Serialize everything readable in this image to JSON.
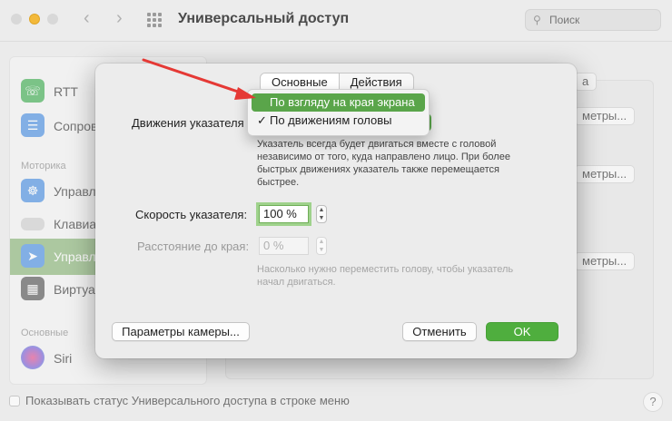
{
  "window": {
    "title": "Универсальный доступ",
    "search_placeholder": "Поиск",
    "back_icon": "‹",
    "forward_icon": "›"
  },
  "sidebar": {
    "items": [
      {
        "label": "RTT",
        "icon": "rtt-icon",
        "color": "#3fae52"
      },
      {
        "label": "Сопров",
        "icon": "captions-icon",
        "color": "#4a90e2"
      },
      {
        "label": "Управл",
        "icon": "switch-control-icon",
        "color": "#4a90e2"
      },
      {
        "label": "Клавиат",
        "icon": "keyboard-icon",
        "color": "#d0d0d0"
      },
      {
        "label": "Управл",
        "icon": "pointer-icon",
        "color": "#4a90e2"
      },
      {
        "label": "Виртуа",
        "icon": "virtual-keyboard-icon",
        "color": "#555555"
      },
      {
        "label": "Siri",
        "icon": "siri-icon",
        "color": "#7a5cd6"
      }
    ],
    "sections": {
      "motor": "Моторика",
      "general": "Основные"
    }
  },
  "background": {
    "params_button": "метры...",
    "params_button_top": "а",
    "footer_checkbox_label": "Показывать статус Универсального доступа в строке меню",
    "help": "?"
  },
  "dialog": {
    "tabs": [
      {
        "label": "Основные",
        "active": true
      },
      {
        "label": "Действия",
        "active": false
      }
    ],
    "movement_label": "Движения указателя",
    "dropdown": {
      "options": [
        {
          "label": "По взгляду на края экрана",
          "highlighted": true,
          "checked": false
        },
        {
          "label": "По движениям головы",
          "highlighted": false,
          "checked": true
        }
      ],
      "check_mark": "✓"
    },
    "movement_description": "Указатель всегда будет двигаться вместе с головой независимо от того, куда направлено лицо. При более быстрых движениях указатель также перемещается быстрее.",
    "speed_label": "Скорость указателя:",
    "speed_value": "100 %",
    "edge_distance_label": "Расстояние до края:",
    "edge_distance_value": "0 %",
    "edge_description": "Насколько нужно переместить голову, чтобы указатель начал двигаться.",
    "camera_button": "Параметры камеры...",
    "cancel_button": "Отменить",
    "ok_button": "OK",
    "accent_color": "#4fae3e"
  },
  "annotation": {
    "arrow_color": "#e53935"
  }
}
